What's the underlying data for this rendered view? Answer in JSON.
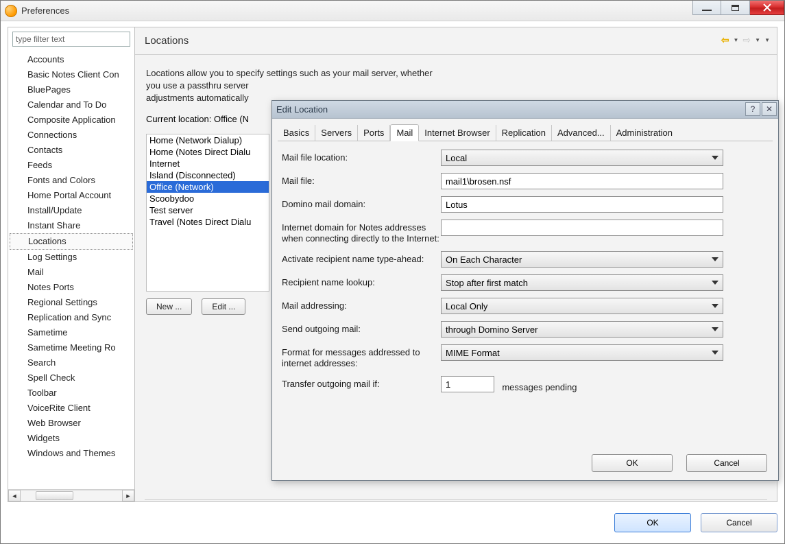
{
  "window": {
    "title": "Preferences"
  },
  "sidebar": {
    "filter_placeholder": "type filter text",
    "items": [
      "Accounts",
      "Basic Notes Client Con",
      "BluePages",
      "Calendar and To Do",
      "Composite Application",
      "Connections",
      "Contacts",
      "Feeds",
      "Fonts and Colors",
      "Home Portal Account",
      "Install/Update",
      "Instant Share",
      "Locations",
      "Log Settings",
      "Mail",
      "Notes Ports",
      "Regional Settings",
      "Replication and Sync",
      "Sametime",
      "Sametime Meeting Ro",
      "Search",
      "Spell Check",
      "Toolbar",
      "VoiceRite Client",
      "Web Browser",
      "Widgets",
      "Windows and Themes"
    ],
    "selected_index": 12
  },
  "main": {
    "title": "Locations",
    "desc_line1": "Locations allow you to specify settings such as your mail server, whether",
    "desc_line2": "you use a passthru server",
    "desc_line3": "adjustments automatically",
    "current_location_label": "Current location: Office (N",
    "locations": [
      "Home (Network Dialup)",
      "Home (Notes Direct Dialu",
      "Internet",
      "Island (Disconnected)",
      "Office (Network)",
      "Scoobydoo",
      "Test server",
      "Travel (Notes Direct Dialu"
    ],
    "locations_selected_index": 4,
    "buttons": {
      "new": "New ...",
      "edit": "Edit ..."
    }
  },
  "dialog": {
    "title": "Edit Location",
    "tabs": [
      "Basics",
      "Servers",
      "Ports",
      "Mail",
      "Internet Browser",
      "Replication",
      "Advanced...",
      "Administration"
    ],
    "active_tab_index": 3,
    "form": {
      "mail_file_location": {
        "label": "Mail file location:",
        "value": "Local"
      },
      "mail_file": {
        "label": "Mail file:",
        "value": "mail1\\brosen.nsf"
      },
      "domino_domain": {
        "label": "Domino mail domain:",
        "value": "Lotus"
      },
      "internet_domain": {
        "label": "Internet domain for Notes addresses when connecting directly to the Internet:",
        "value": ""
      },
      "typeahead": {
        "label": "Activate recipient name type-ahead:",
        "value": "On Each Character"
      },
      "lookup": {
        "label": "Recipient name lookup:",
        "value": "Stop after first match"
      },
      "addressing": {
        "label": "Mail addressing:",
        "value": "Local Only"
      },
      "outgoing": {
        "label": "Send outgoing mail:",
        "value": "through Domino Server"
      },
      "format": {
        "label": "Format for messages addressed to internet addresses:",
        "value": "MIME Format"
      },
      "transfer": {
        "label": "Transfer outgoing mail if:",
        "value": "1",
        "suffix": "messages pending"
      }
    },
    "buttons": {
      "ok": "OK",
      "cancel": "Cancel"
    }
  },
  "footer": {
    "ok": "OK",
    "cancel": "Cancel"
  }
}
